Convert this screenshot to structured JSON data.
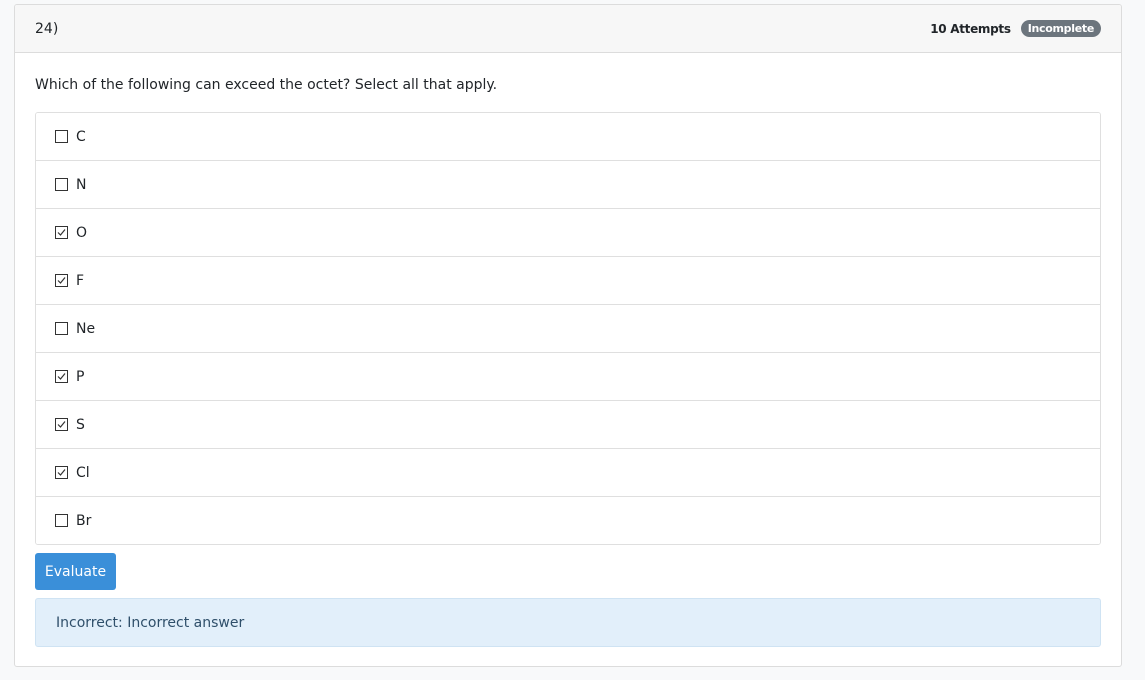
{
  "question": {
    "number": "24)",
    "attempts": "10 Attempts",
    "status": "Incomplete",
    "prompt": "Which of the following can exceed the octet?  Select all that apply."
  },
  "options": [
    {
      "label": "C",
      "checked": false
    },
    {
      "label": "N",
      "checked": false
    },
    {
      "label": "O",
      "checked": true
    },
    {
      "label": "F",
      "checked": true
    },
    {
      "label": "Ne",
      "checked": false
    },
    {
      "label": "P",
      "checked": true
    },
    {
      "label": "S",
      "checked": true
    },
    {
      "label": "Cl",
      "checked": true
    },
    {
      "label": "Br",
      "checked": false
    }
  ],
  "actions": {
    "evaluate_label": "Evaluate"
  },
  "feedback": {
    "text": "Incorrect: Incorrect answer"
  },
  "colors": {
    "primary_button": "#3a8fd9",
    "badge": "#6c757d",
    "feedback_bg": "#e2effa"
  }
}
